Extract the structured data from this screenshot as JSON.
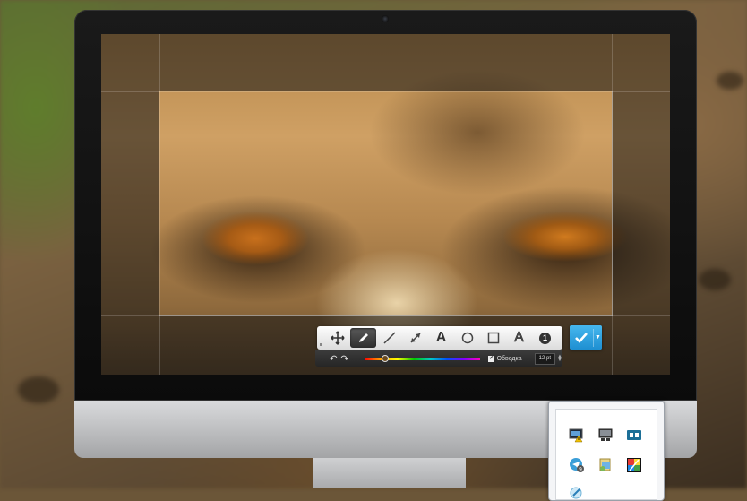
{
  "toolbar": {
    "tools": [
      {
        "name": "move-tool",
        "icon": "move-icon"
      },
      {
        "name": "pencil-tool",
        "icon": "pencil-icon",
        "active": true
      },
      {
        "name": "line-tool",
        "icon": "line-icon"
      },
      {
        "name": "arrow-tool",
        "icon": "arrow-icon"
      },
      {
        "name": "text-tool",
        "icon": "text-icon",
        "label": "A"
      },
      {
        "name": "ellipse-tool",
        "icon": "ellipse-icon"
      },
      {
        "name": "rectangle-tool",
        "icon": "rectangle-icon"
      },
      {
        "name": "text-outline-tool",
        "icon": "text-outline-icon",
        "label": "A"
      },
      {
        "name": "counter-tool",
        "icon": "counter-icon",
        "label": "1"
      }
    ],
    "confirm_icon": "check-icon",
    "dropdown_icon": "chevron-down-icon"
  },
  "subbar": {
    "undo_icon": "undo-icon",
    "redo_icon": "redo-icon",
    "outline_label": "Обводка",
    "outline_checked": "✔",
    "font_size": "12 pt",
    "color_position": 0.18
  },
  "tray": {
    "icons": [
      "monitor-warning-icon",
      "display-icon",
      "screen-capture-icon",
      "telegram-icon",
      "network-icon",
      "color-picker-icon",
      "pen-icon"
    ]
  },
  "colors": {
    "accent": "#2aa1e0"
  }
}
